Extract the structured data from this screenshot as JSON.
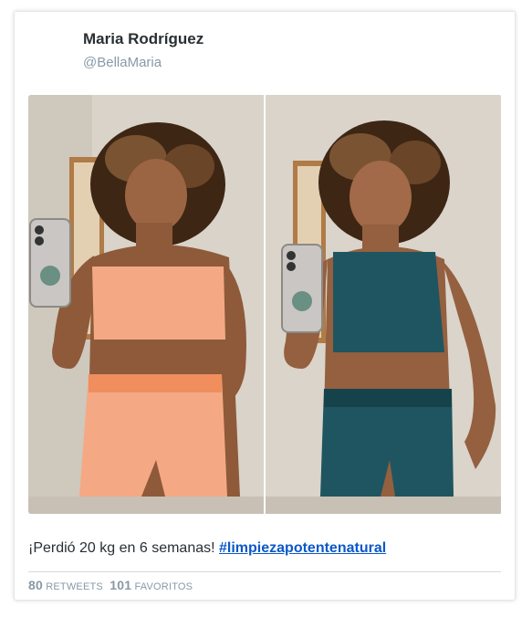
{
  "tweet": {
    "user": {
      "name": "Maria Rodríguez",
      "handle": "@BellaMaria"
    },
    "media": {
      "count": 2,
      "left_outfit_color": "#f4a984",
      "right_outfit_color": "#1f5560"
    },
    "text": "¡Perdió 20 kg en 6 semanas! ",
    "hashtag": "#limpiezapotentenatural",
    "stats": {
      "retweets_count": "80",
      "retweets_label": "RETWEETS",
      "favorites_count": "101",
      "favorites_label": "FAVORITOS"
    }
  }
}
